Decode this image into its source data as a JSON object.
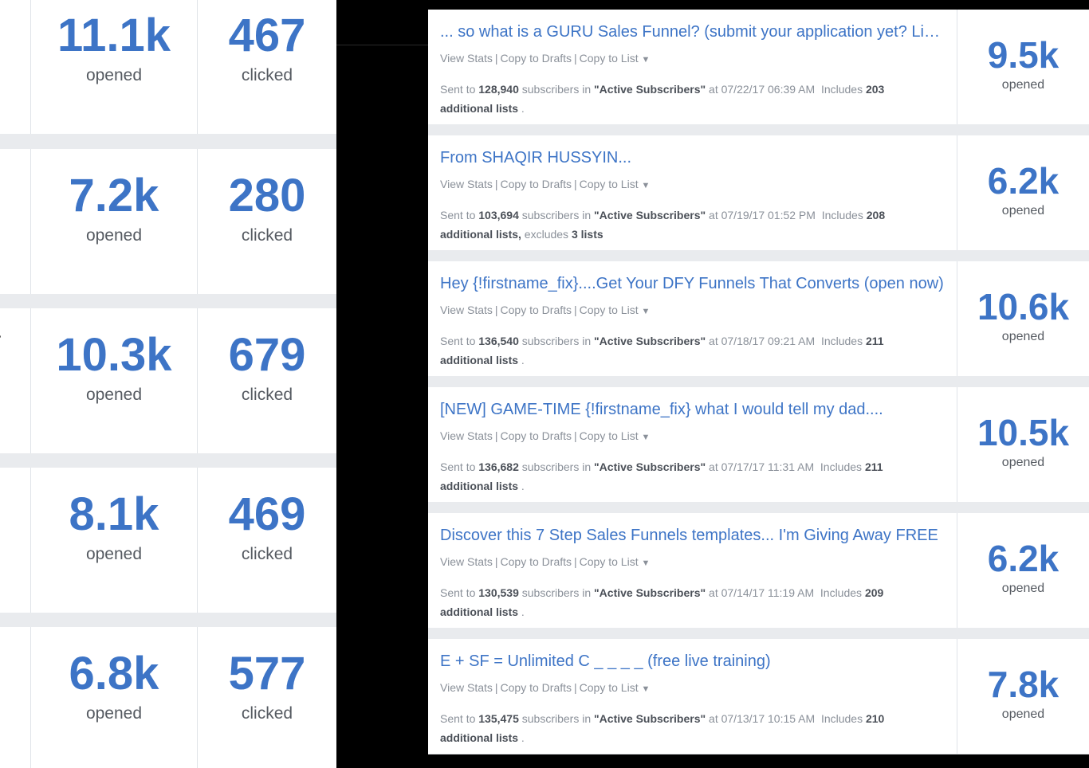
{
  "left_rows": [
    {
      "opened": "11.1k",
      "opened_label": "opened",
      "clicked": "467",
      "clicked_label": "clicked"
    },
    {
      "opened": "7.2k",
      "opened_label": "opened",
      "clicked": "280",
      "clicked_label": "clicked"
    },
    {
      "opened": "10.3k",
      "opened_label": "opened",
      "clicked": "679",
      "clicked_label": "clicked"
    },
    {
      "opened": "8.1k",
      "opened_label": "opened",
      "clicked": "469",
      "clicked_label": "clicked"
    },
    {
      "opened": "6.8k",
      "opened_label": "opened",
      "clicked": "577",
      "clicked_label": "clicked"
    }
  ],
  "actions": {
    "view_stats": "View Stats",
    "copy_drafts": "Copy to Drafts",
    "copy_list": "Copy to List",
    "sep": "|",
    "caret": "▼"
  },
  "sent_words": {
    "sent_to": "Sent to",
    "subscribers_in": "subscribers in",
    "at": "at",
    "includes": "Includes",
    "excludes": "excludes"
  },
  "broadcasts": [
    {
      "subject": "... so what is a GURU Sales Funnel? (submit your application yet? Limited spots)",
      "count": "128,940",
      "list": "\"Active Subscribers\"",
      "datetime": "07/22/17 06:39 AM",
      "includes": "203",
      "lists_text": "additional lists",
      "tail": " .",
      "excludes": "",
      "excludes_lists": "",
      "opened": "9.5k",
      "opened_label": "opened"
    },
    {
      "subject": "From SHAQIR HUSSYIN...",
      "count": "103,694",
      "list": "\"Active Subscribers\"",
      "datetime": "07/19/17 01:52 PM",
      "includes": "208",
      "lists_text": "additional lists,",
      "tail": "",
      "excludes": "excludes",
      "excludes_lists": "3 lists",
      "opened": "6.2k",
      "opened_label": "opened"
    },
    {
      "subject": "Hey {!firstname_fix}....Get Your DFY Funnels That Converts (open now)",
      "count": "136,540",
      "list": "\"Active Subscribers\"",
      "datetime": "07/18/17 09:21 AM",
      "includes": "211",
      "lists_text": "additional lists",
      "tail": " .",
      "excludes": "",
      "excludes_lists": "",
      "opened": "10.6k",
      "opened_label": "opened"
    },
    {
      "subject": "[NEW] GAME-TIME {!firstname_fix} what I would tell my dad....",
      "count": "136,682",
      "list": "\"Active Subscribers\"",
      "datetime": "07/17/17 11:31 AM",
      "includes": "211",
      "lists_text": "additional lists",
      "tail": " .",
      "excludes": "",
      "excludes_lists": "",
      "opened": "10.5k",
      "opened_label": "opened"
    },
    {
      "subject": "Discover this 7 Step Sales Funnels templates... I'm Giving Away FREE",
      "count": "130,539",
      "list": "\"Active Subscribers\"",
      "datetime": "07/14/17 11:19 AM",
      "includes": "209",
      "lists_text": "additional lists",
      "tail": " .",
      "excludes": "",
      "excludes_lists": "",
      "opened": "6.2k",
      "opened_label": "opened"
    },
    {
      "subject": "E + SF = Unlimited C _ _ _ _ (free live training)",
      "count": "135,475",
      "list": "\"Active Subscribers\"",
      "datetime": "07/13/17 10:15 AM",
      "includes": "210",
      "lists_text": "additional lists",
      "tail": " .",
      "excludes": "",
      "excludes_lists": "",
      "opened": "7.8k",
      "opened_label": "opened"
    }
  ]
}
